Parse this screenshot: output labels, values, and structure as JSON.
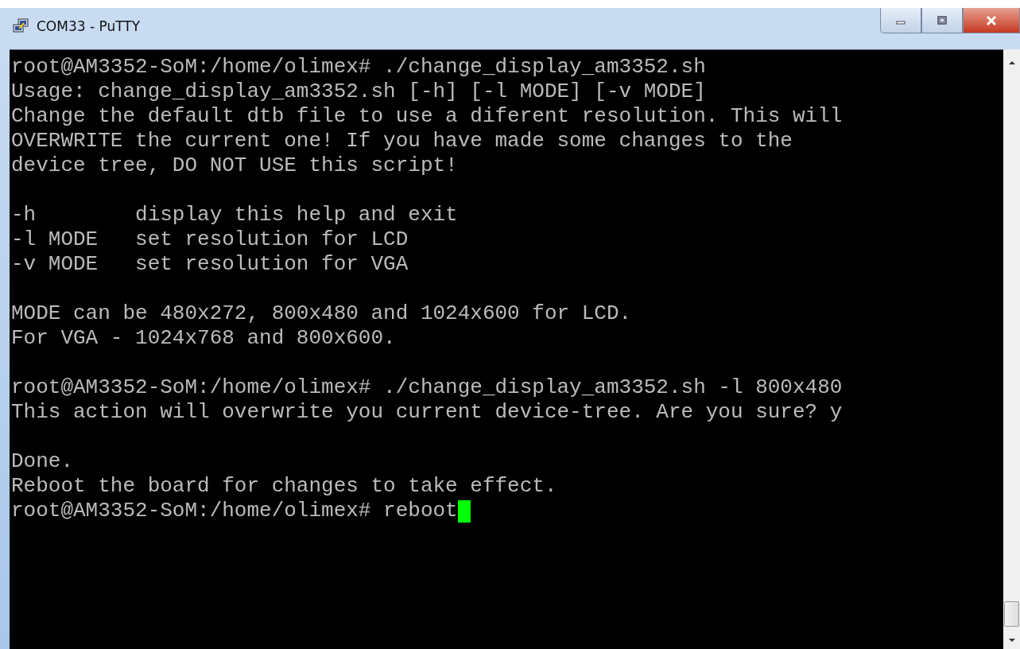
{
  "window": {
    "title": "COM33 - PuTTY"
  },
  "terminal": {
    "blocks": [
      [
        "root@AM3352-SoM:/home/olimex# ./change_display_am3352.sh",
        "Usage: change_display_am3352.sh [-h] [-l MODE] [-v MODE]",
        "Change the default dtb file to use a diferent resolution. This will",
        "OVERWRITE the current one! If you have made some changes to the",
        "device tree, DO NOT USE this script!"
      ],
      [
        "-h        display this help and exit",
        "-l MODE   set resolution for LCD",
        "-v MODE   set resolution for VGA"
      ],
      [
        "MODE can be 480x272, 800x480 and 1024x600 for LCD.",
        "For VGA - 1024x768 and 800x600."
      ],
      [
        "root@AM3352-SoM:/home/olimex# ./change_display_am3352.sh -l 800x480",
        "This action will overwrite you current device-tree. Are you sure? y"
      ],
      [
        "Done.",
        "Reboot the board for changes to take effect.",
        "root@AM3352-SoM:/home/olimex# reboot"
      ]
    ]
  }
}
